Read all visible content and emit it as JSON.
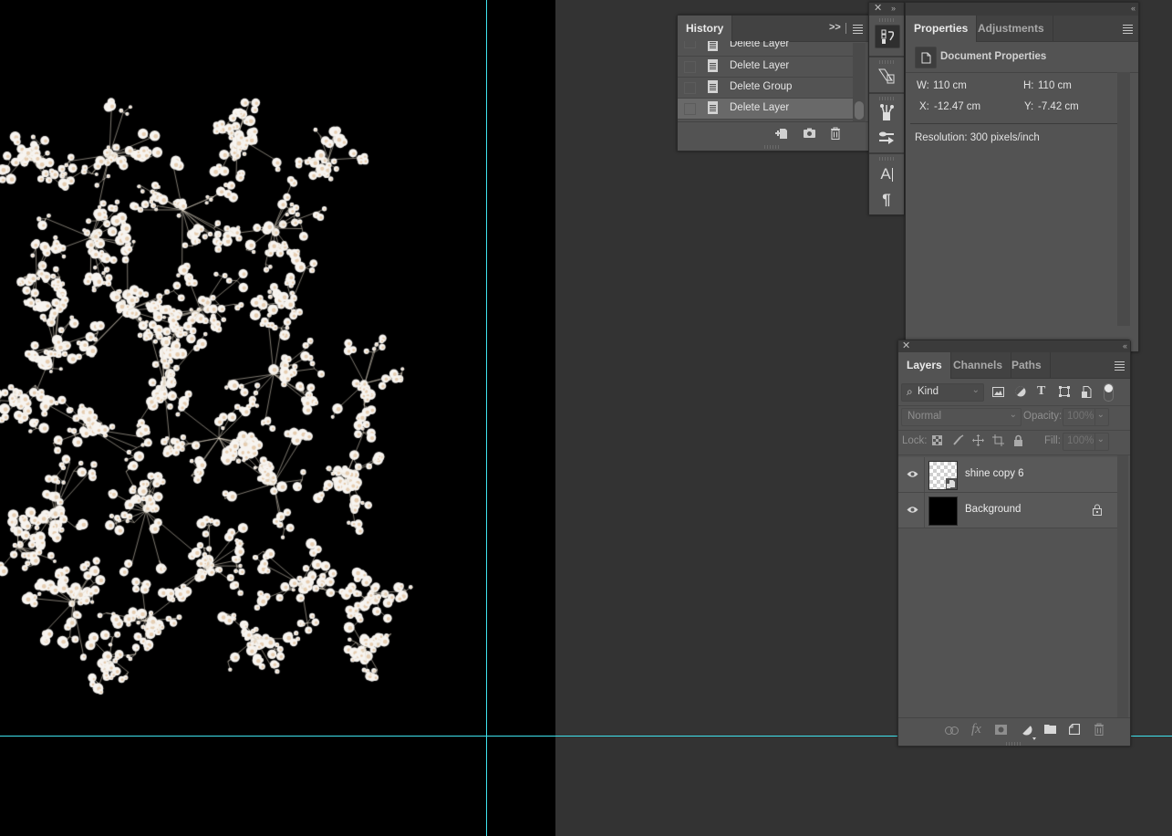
{
  "canvas": {
    "background_color": "#000000",
    "guide_color": "#3fe3ee",
    "artwork": "baby's breath (gypsophila) flowers on black"
  },
  "history": {
    "tab_label": "History",
    "expand_glyph": ">>",
    "items": [
      {
        "label": "Delete Layer",
        "selected": false
      },
      {
        "label": "Delete Layer",
        "selected": false
      },
      {
        "label": "Delete Group",
        "selected": false
      },
      {
        "label": "Delete Layer",
        "selected": true
      }
    ],
    "footer_icons": [
      "new-document-from-state-icon",
      "camera-snapshot-icon",
      "trash-icon"
    ]
  },
  "toolstrip": {
    "buttons": [
      "history-icon",
      "3d-transform-icon",
      "brushes-icon",
      "brush-settings-icon",
      "character-icon",
      "paragraph-icon"
    ],
    "character_glyph": "A",
    "paragraph_glyph": "¶"
  },
  "properties": {
    "tabs": [
      {
        "label": "Properties",
        "active": true
      },
      {
        "label": "Adjustments",
        "active": false
      }
    ],
    "section_title": "Document Properties",
    "w_label": "W:",
    "w_value": "110 cm",
    "h_label": "H:",
    "h_value": "110 cm",
    "x_label": "X:",
    "x_value": "-12.47 cm",
    "y_label": "Y:",
    "y_value": "-7.42 cm",
    "resolution": "Resolution: 300 pixels/inch"
  },
  "layers": {
    "tabs": [
      {
        "label": "Layers",
        "active": true
      },
      {
        "label": "Channels",
        "active": false
      },
      {
        "label": "Paths",
        "active": false
      }
    ],
    "filter_kind": "Kind",
    "blend_mode": "Normal",
    "opacity_label": "Opacity:",
    "opacity_value": "100%",
    "lock_label": "Lock:",
    "fill_label": "Fill:",
    "fill_value": "100%",
    "items": [
      {
        "name": "shine copy 6",
        "visible": true,
        "locked": false,
        "smart_object": true
      },
      {
        "name": "Background",
        "visible": true,
        "locked": true,
        "smart_object": false
      }
    ],
    "footer_icons": [
      "link-layers-icon",
      "fx-icon",
      "add-mask-icon",
      "adjustment-layer-icon",
      "new-group-icon",
      "new-layer-icon",
      "delete-layer-icon"
    ],
    "fx_glyph": "fx"
  }
}
